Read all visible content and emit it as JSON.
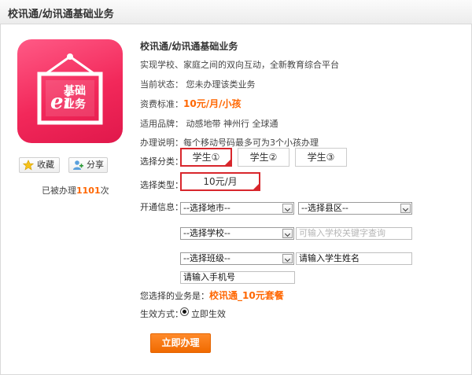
{
  "header": {
    "title": "校讯通/幼讯通基础业务"
  },
  "logo": {
    "text_line1": "基础",
    "text_line2": "业务",
    "symbol": "ei"
  },
  "sidebar": {
    "favorite_label": "收藏",
    "share_label": "分享",
    "count_prefix": "已被办理",
    "count_value": "1101",
    "count_suffix": "次"
  },
  "product": {
    "name": "校讯通/幼讯通基础业务",
    "slogan": "实现学校、家庭之间的双向互动，全新教育综合平台",
    "status": "当前状态： 您未办理该类业务",
    "fee_label": "资费标准：",
    "fee_value": "10元/月/小孩",
    "brands": "适用品牌： 动感地带 神州行 全球通",
    "note": "办理说明：每个移动号码最多可为3个小孩办理"
  },
  "form": {
    "category_label": "选择分类：",
    "categories": [
      "学生①",
      "学生②",
      "学生③"
    ],
    "type_label": "选择类型：",
    "type_value": "10元/月",
    "info_label": "开通信息：",
    "city_select": "--选择地市--",
    "county_select": "--选择县区--",
    "school_select": "--选择学校--",
    "school_search_placeholder": "可输入学校关键字查询",
    "class_select": "--选择班级--",
    "student_name_value": "请输入学生姓名",
    "phone_value": "请输入手机号",
    "chosen_prefix": "您选择的业务是：",
    "chosen_value": "校讯通_10元套餐",
    "effect_label": "生效方式：",
    "effect_option": "立即生效",
    "submit_label": "立即办理"
  },
  "colors": {
    "accent": "#ff6600",
    "selected_border": "#d8262c",
    "logo_bg": "#f2285a"
  }
}
